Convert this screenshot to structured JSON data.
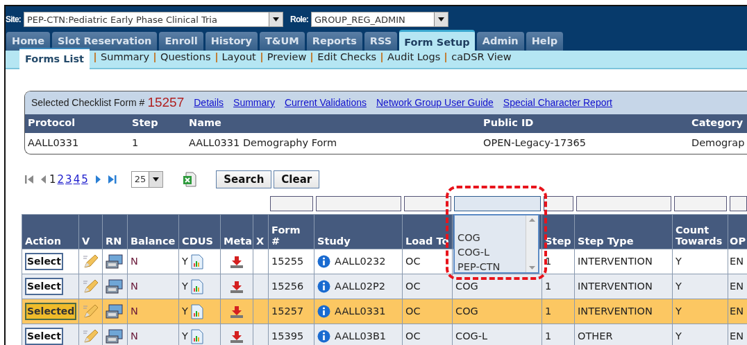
{
  "site": {
    "label": "Site:",
    "value": "PEP-CTN:Pediatric Early Phase Clinical Tria"
  },
  "role": {
    "label": "Role:",
    "value": "GROUP_REG_ADMIN"
  },
  "tabs": [
    {
      "label": "Home",
      "selected": false
    },
    {
      "label": "Slot Reservation",
      "selected": false
    },
    {
      "label": "Enroll",
      "selected": false
    },
    {
      "label": "History",
      "selected": false
    },
    {
      "label": "T&UM",
      "selected": false
    },
    {
      "label": "Reports",
      "selected": false
    },
    {
      "label": "RSS",
      "selected": false
    },
    {
      "label": "Form Setup",
      "selected": true
    },
    {
      "label": "Admin",
      "selected": false
    },
    {
      "label": "Help",
      "selected": false
    }
  ],
  "subtabs": [
    {
      "label": "Forms List",
      "selected": true
    },
    {
      "label": "Summary",
      "selected": false
    },
    {
      "label": "Questions",
      "selected": false
    },
    {
      "label": "Layout",
      "selected": false
    },
    {
      "label": "Preview",
      "selected": false
    },
    {
      "label": "Edit Checks",
      "selected": false
    },
    {
      "label": "Audit Logs",
      "selected": false
    },
    {
      "label": "caDSR View",
      "selected": false
    }
  ],
  "selected_form": {
    "label": "Selected Checklist Form #",
    "number": "15257",
    "links": [
      "Details",
      "Summary",
      "Current Validations",
      "Network Group User Guide",
      "Special Character Report"
    ],
    "columns": [
      "Protocol",
      "Step",
      "Name",
      "Public ID",
      "Category"
    ],
    "row": [
      "AALL0331",
      "1",
      "AALL0331 Demography Form",
      "OPEN-Legacy-17365",
      "Demograp"
    ]
  },
  "pager": {
    "pages": [
      {
        "label": "1",
        "selected": true
      },
      {
        "label": "2",
        "selected": false
      },
      {
        "label": "3",
        "selected": false
      },
      {
        "label": "4",
        "selected": false
      },
      {
        "label": "5",
        "selected": false
      }
    ],
    "page_size": "25",
    "buttons": [
      "Search",
      "Clear"
    ]
  },
  "filters": [
    {
      "active": false
    },
    {
      "active": false
    },
    {
      "active": false
    },
    {
      "active": true
    },
    {
      "active": false
    },
    {
      "active": false
    },
    {
      "active": false
    },
    {
      "active": false
    }
  ],
  "filter_dropdown": {
    "options": [
      "COG",
      "COG-L",
      "PEP-CTN"
    ]
  },
  "table": {
    "columns": [
      "Action",
      "V",
      "RN",
      "Balance",
      "CDUS",
      "Meta",
      "X",
      "Form #",
      "Study",
      "Load To",
      null,
      "Step",
      "Step Type",
      "Count Towards",
      "OP"
    ],
    "rows": [
      {
        "selected": false,
        "action": "Select",
        "balance": "N",
        "cdus": "Y",
        "form": "15255",
        "study": "AALL0232",
        "load_to": "OC",
        "column_11": null,
        "step": "1",
        "step_type": "INTERVENTION",
        "count_towards": "Y",
        "column_15": "EN"
      },
      {
        "selected": false,
        "action": "Select",
        "balance": "N",
        "cdus": "Y",
        "form": "15256",
        "study": "AALL02P2",
        "load_to": "OC",
        "column_11": "COG",
        "step": "1",
        "step_type": "INTERVENTION",
        "count_towards": "Y",
        "column_15": "EN"
      },
      {
        "selected": true,
        "action": "Selected",
        "balance": "N",
        "cdus": "Y",
        "form": "15257",
        "study": "AALL0331",
        "load_to": "OC",
        "column_11": "COG",
        "step": "1",
        "step_type": "INTERVENTION",
        "count_towards": "Y",
        "column_15": "EN"
      },
      {
        "selected": false,
        "action": "Select",
        "balance": "N",
        "cdus": "Y",
        "form": "15395",
        "study": "AALL03B1",
        "load_to": "OC",
        "column_11": "COG-L",
        "step": "1",
        "step_type": "OTHER",
        "count_towards": "Y",
        "column_15": "EN"
      }
    ]
  }
}
